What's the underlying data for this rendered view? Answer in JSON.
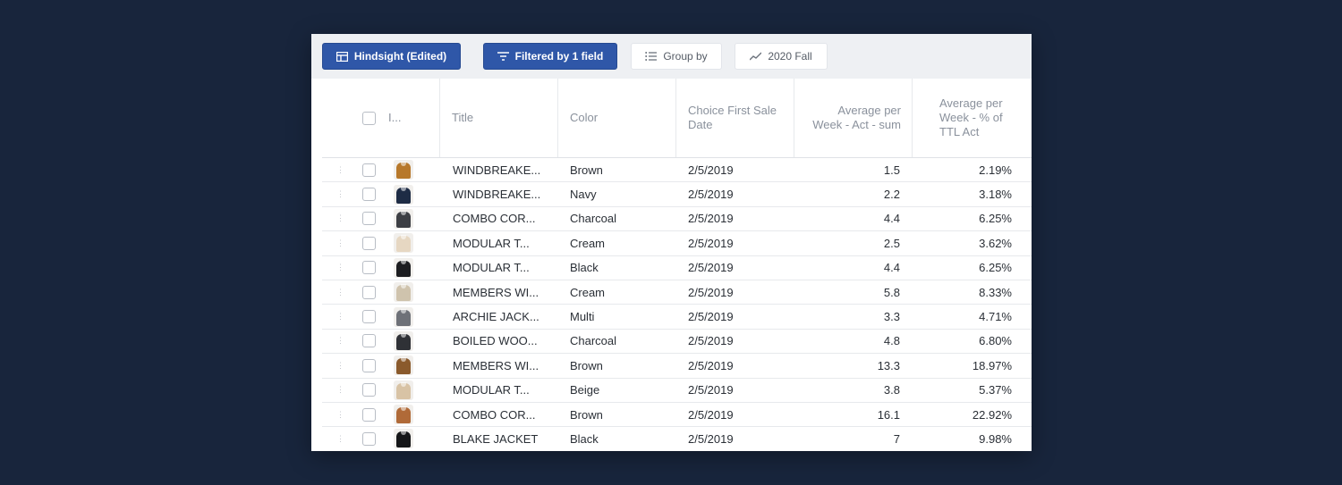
{
  "toolbar": {
    "view_label": "Hindsight (Edited)",
    "filter_label": "Filtered by 1 field",
    "group_label": "Group by",
    "season_label": "2020 Fall"
  },
  "columns": {
    "image_short": "I...",
    "title": "Title",
    "color": "Color",
    "first_sale": "Choice First Sale Date",
    "avg_week": "Average per Week - Act - sum",
    "avg_pct": "Average per Week - % of TTL Act"
  },
  "rows": [
    {
      "title": "WINDBREAKE...",
      "color": "Brown",
      "date": "2/5/2019",
      "avg": "1.5",
      "pct": "2.19%",
      "swatch": "#b7782a"
    },
    {
      "title": "WINDBREAKE...",
      "color": "Navy",
      "date": "2/5/2019",
      "avg": "2.2",
      "pct": "3.18%",
      "swatch": "#1e2c45"
    },
    {
      "title": "COMBO COR...",
      "color": "Charcoal",
      "date": "2/5/2019",
      "avg": "4.4",
      "pct": "6.25%",
      "swatch": "#3d3f44"
    },
    {
      "title": "MODULAR T...",
      "color": "Cream",
      "date": "2/5/2019",
      "avg": "2.5",
      "pct": "3.62%",
      "swatch": "#e6d7c2"
    },
    {
      "title": "MODULAR T...",
      "color": "Black",
      "date": "2/5/2019",
      "avg": "4.4",
      "pct": "6.25%",
      "swatch": "#1c1d20"
    },
    {
      "title": "MEMBERS WI...",
      "color": "Cream",
      "date": "2/5/2019",
      "avg": "5.8",
      "pct": "8.33%",
      "swatch": "#cfc3ad"
    },
    {
      "title": "ARCHIE JACK...",
      "color": "Multi",
      "date": "2/5/2019",
      "avg": "3.3",
      "pct": "4.71%",
      "swatch": "#6e7178"
    },
    {
      "title": "BOILED WOO...",
      "color": "Charcoal",
      "date": "2/5/2019",
      "avg": "4.8",
      "pct": "6.80%",
      "swatch": "#2f3136"
    },
    {
      "title": "MEMBERS WI...",
      "color": "Brown",
      "date": "2/5/2019",
      "avg": "13.3",
      "pct": "18.97%",
      "swatch": "#8a5a2c"
    },
    {
      "title": "MODULAR T...",
      "color": "Beige",
      "date": "2/5/2019",
      "avg": "3.8",
      "pct": "5.37%",
      "swatch": "#d8c3a5"
    },
    {
      "title": "COMBO COR...",
      "color": "Brown",
      "date": "2/5/2019",
      "avg": "16.1",
      "pct": "22.92%",
      "swatch": "#b06a38"
    },
    {
      "title": "BLAKE JACKET",
      "color": "Black",
      "date": "2/5/2019",
      "avg": "7",
      "pct": "9.98%",
      "swatch": "#151618"
    }
  ]
}
